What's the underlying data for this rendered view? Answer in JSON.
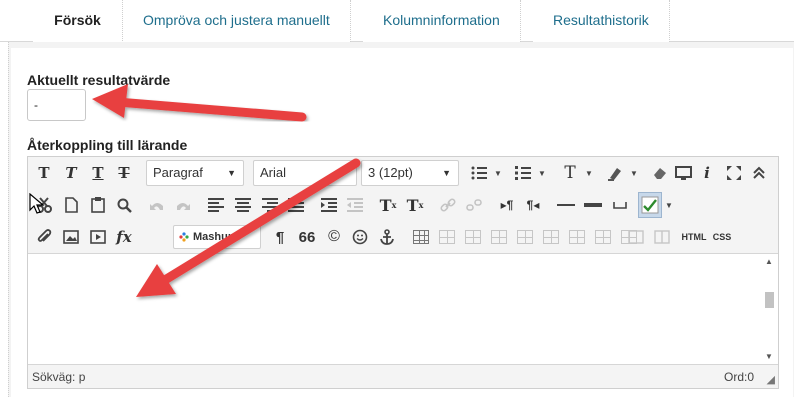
{
  "tabs": [
    {
      "label": "Försök",
      "active": true
    },
    {
      "label": "Ompröva och justera manuellt",
      "active": false
    },
    {
      "label": "Kolumninformation",
      "active": false
    },
    {
      "label": "Resultathistorik",
      "active": false
    }
  ],
  "current_grade": {
    "label": "Aktuellt resultatvärde",
    "value": "-"
  },
  "feedback": {
    "label": "Återkoppling till lärande"
  },
  "toolbar": {
    "paragraph_select": "Paragraf",
    "font_select": "Arial",
    "size_select": "3 (12pt)",
    "mashups_label": "Mashups",
    "html_label": "HTML",
    "css_label": "CSS",
    "text_t_glyph": "T",
    "italic_glyph": "i",
    "quote_glyph": "66",
    "copyright_glyph": "©",
    "fx_glyph": "fx"
  },
  "status": {
    "path": "Sökväg: p",
    "word_count": "Ord:0"
  },
  "colors": {
    "accent_link": "#1e6e8c",
    "annotation_arrow": "#e8403f"
  }
}
